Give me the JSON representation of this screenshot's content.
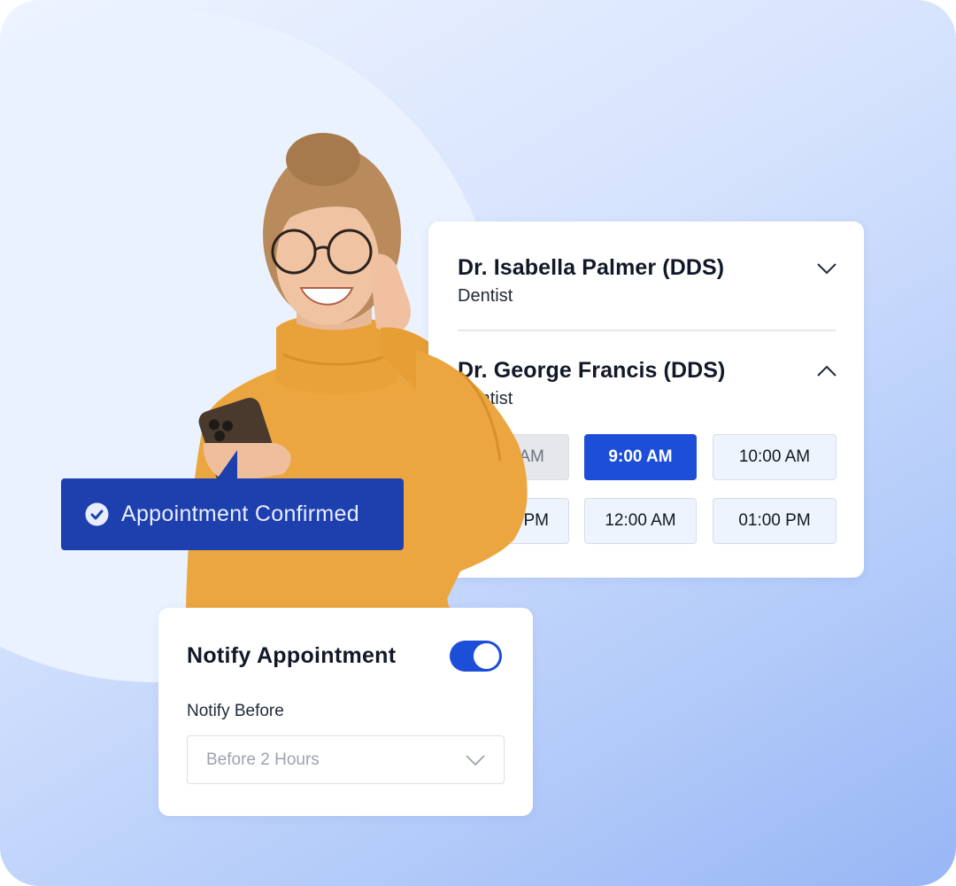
{
  "doctors": [
    {
      "name": "Dr. Isabella Palmer (DDS)",
      "role": "Dentist",
      "expanded": false,
      "toggle_icon": "chevron-down-icon"
    },
    {
      "name": "Dr. George Francis (DDS)",
      "role": "Dentist",
      "expanded": true,
      "toggle_icon": "chevron-up-icon"
    }
  ],
  "time_slots": [
    {
      "label": "8:00 AM",
      "state": "disabled"
    },
    {
      "label": "9:00 AM",
      "state": "selected"
    },
    {
      "label": "10:00 AM",
      "state": "available"
    },
    {
      "label": "11:00 PM",
      "state": "available"
    },
    {
      "label": "12:00 AM",
      "state": "available"
    },
    {
      "label": "01:00 PM",
      "state": "available"
    }
  ],
  "confirmation": {
    "icon": "check-circle-icon",
    "text": "Appointment Confirmed"
  },
  "notify": {
    "title": "Notify Appointment",
    "enabled": true,
    "before_label": "Notify Before",
    "before_value": "Before 2 Hours",
    "select_icon": "chevron-down-icon"
  },
  "colors": {
    "accent": "#1d4ed8",
    "banner": "#1e3fae",
    "sweater": "#eaa640"
  }
}
